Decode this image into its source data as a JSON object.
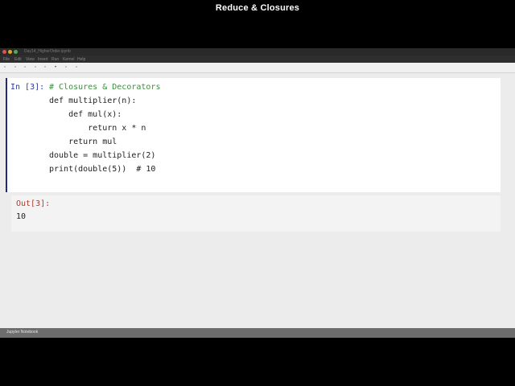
{
  "window": {
    "title": "Day14_HigherOrder.ipynb",
    "overlay_title": "Reduce & Closures"
  },
  "menu": [
    "File",
    "Edit",
    "View",
    "Insert",
    "Run",
    "Kernel",
    "Help"
  ],
  "toolbar_icons": [
    "save-icon",
    "add-cell-icon",
    "cut-icon",
    "copy-icon",
    "paste-icon",
    "run-icon",
    "stop-icon",
    "restart-icon"
  ],
  "cell": {
    "prompt_in": "In [3]:",
    "lines": [
      "# Closures & Decorators",
      "def multiplier(n):",
      "    def mul(x):",
      "        return x * n",
      "    return mul",
      "double = multiplier(2)",
      "print(double(5))  # 10"
    ],
    "prompt_out": "Out[3]:",
    "output": "10"
  },
  "status": {
    "label": "Jupyter Notebook"
  },
  "colors": {
    "cell_border": "#1e2a7a",
    "prompt_in": "#2f3aa3",
    "prompt_out": "#b03a2e",
    "comment": "#3f8f3f"
  }
}
